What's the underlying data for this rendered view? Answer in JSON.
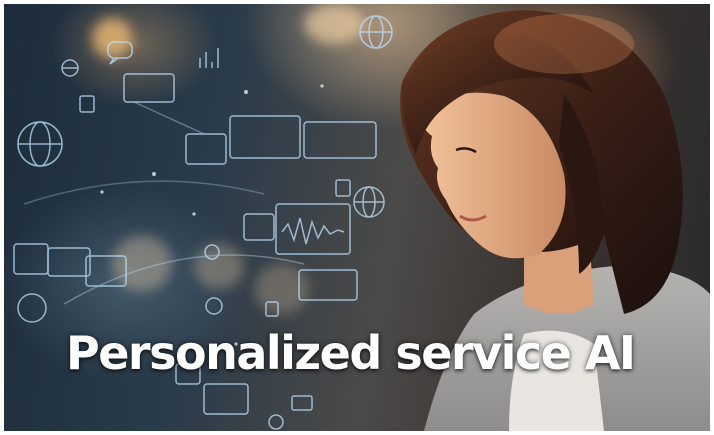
{
  "image": {
    "caption": "Personalized service AI",
    "subject": "woman-using-laptop-with-hologram-interface"
  }
}
